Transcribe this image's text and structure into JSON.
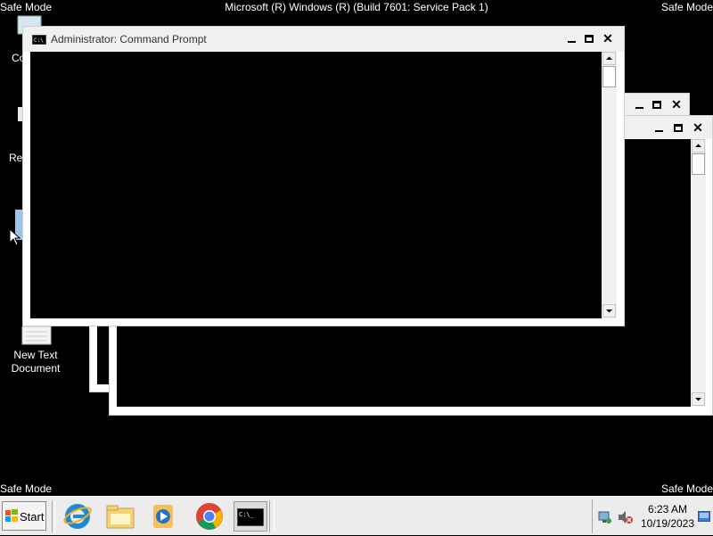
{
  "overlay": {
    "safe_mode_label": "Safe Mode",
    "os_banner": "Microsoft (R) Windows (R) (Build 7601: Service Pack 1)"
  },
  "desktop": {
    "icons": [
      {
        "label": "Co",
        "icon": "computer-icon"
      },
      {
        "label": "Re",
        "icon": "recycle-bin-icon"
      },
      {
        "label": "",
        "icon": "folder-icon"
      },
      {
        "label": "New Text Document",
        "icon": "text-document-icon"
      }
    ]
  },
  "windows": {
    "front": {
      "title": "Administrator:  Command Prompt",
      "icon": "cmd-icon",
      "controls": [
        "minimize",
        "maximize",
        "close"
      ]
    },
    "back1": {
      "title": "",
      "controls": [
        "minimize",
        "maximize",
        "close"
      ]
    },
    "back2": {
      "title": "",
      "controls": [
        "minimize",
        "maximize",
        "close"
      ]
    }
  },
  "taskbar": {
    "start_label": "Start",
    "pinned": [
      "internet-explorer-icon",
      "windows-explorer-icon",
      "media-player-icon",
      "chrome-icon",
      "command-prompt-icon"
    ],
    "tray": {
      "icons": [
        "network-icon",
        "volume-muted-icon",
        "show-desktop-icon"
      ],
      "time": "6:23 AM",
      "date": "10/19/2023"
    }
  }
}
